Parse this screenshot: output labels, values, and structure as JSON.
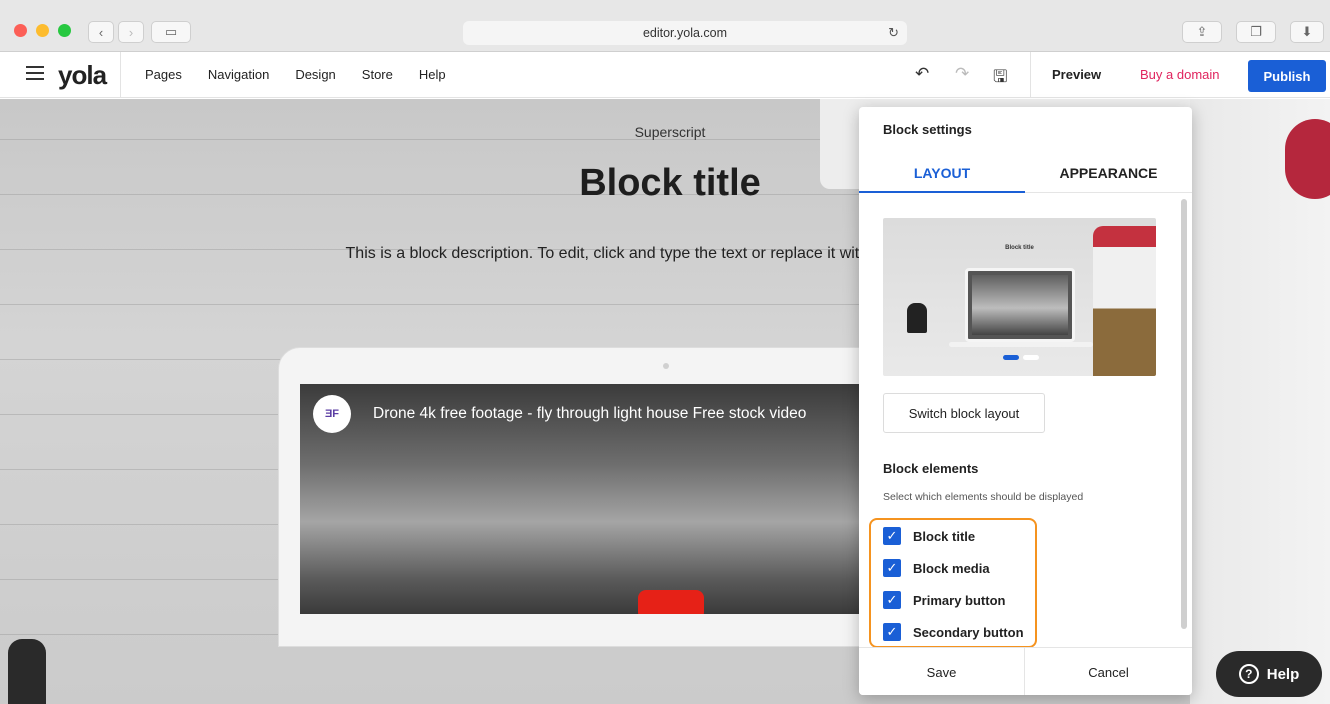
{
  "browser": {
    "url": "editor.yola.com",
    "back_icon": "chevron-left",
    "forward_icon": "chevron-right",
    "sidebar_icon": "sidebar",
    "reload_icon": "reload",
    "share_icon": "share",
    "tabs_icon": "tabs",
    "download_icon": "download"
  },
  "toolbar": {
    "logo": "yola",
    "nav": [
      "Pages",
      "Navigation",
      "Design",
      "Store",
      "Help"
    ],
    "undo_glyph": "↶",
    "redo_glyph": "↷",
    "save_glyph": "🖫",
    "preview_label": "Preview",
    "buy_domain_label": "Buy a domain",
    "publish_label": "Publish",
    "colors": {
      "publish": "#1a5fd6",
      "buy_domain": "#e0245e"
    }
  },
  "block": {
    "superscript": "Superscript",
    "title": "Block title",
    "description": "This is a block description. To edit, click and type the text or replace it with your own content",
    "video_title": "Drone 4k free footage - fly through light house Free stock video",
    "video_avatar": "ƎF"
  },
  "panel": {
    "title": "Block settings",
    "tabs": [
      "LAYOUT",
      "APPEARANCE"
    ],
    "active_tab": "LAYOUT",
    "thumb_title": "Block title",
    "switch_layout_label": "Switch block layout",
    "elements_title": "Block elements",
    "elements_subtitle": "Select which elements should be displayed",
    "elements": [
      {
        "label": "Block title",
        "checked": true
      },
      {
        "label": "Block media",
        "checked": true
      },
      {
        "label": "Primary button",
        "checked": true
      },
      {
        "label": "Secondary button",
        "checked": true
      }
    ],
    "save_label": "Save",
    "cancel_label": "Cancel",
    "highlight_color": "#f5931f"
  },
  "help": {
    "label": "Help",
    "icon_glyph": "?"
  }
}
